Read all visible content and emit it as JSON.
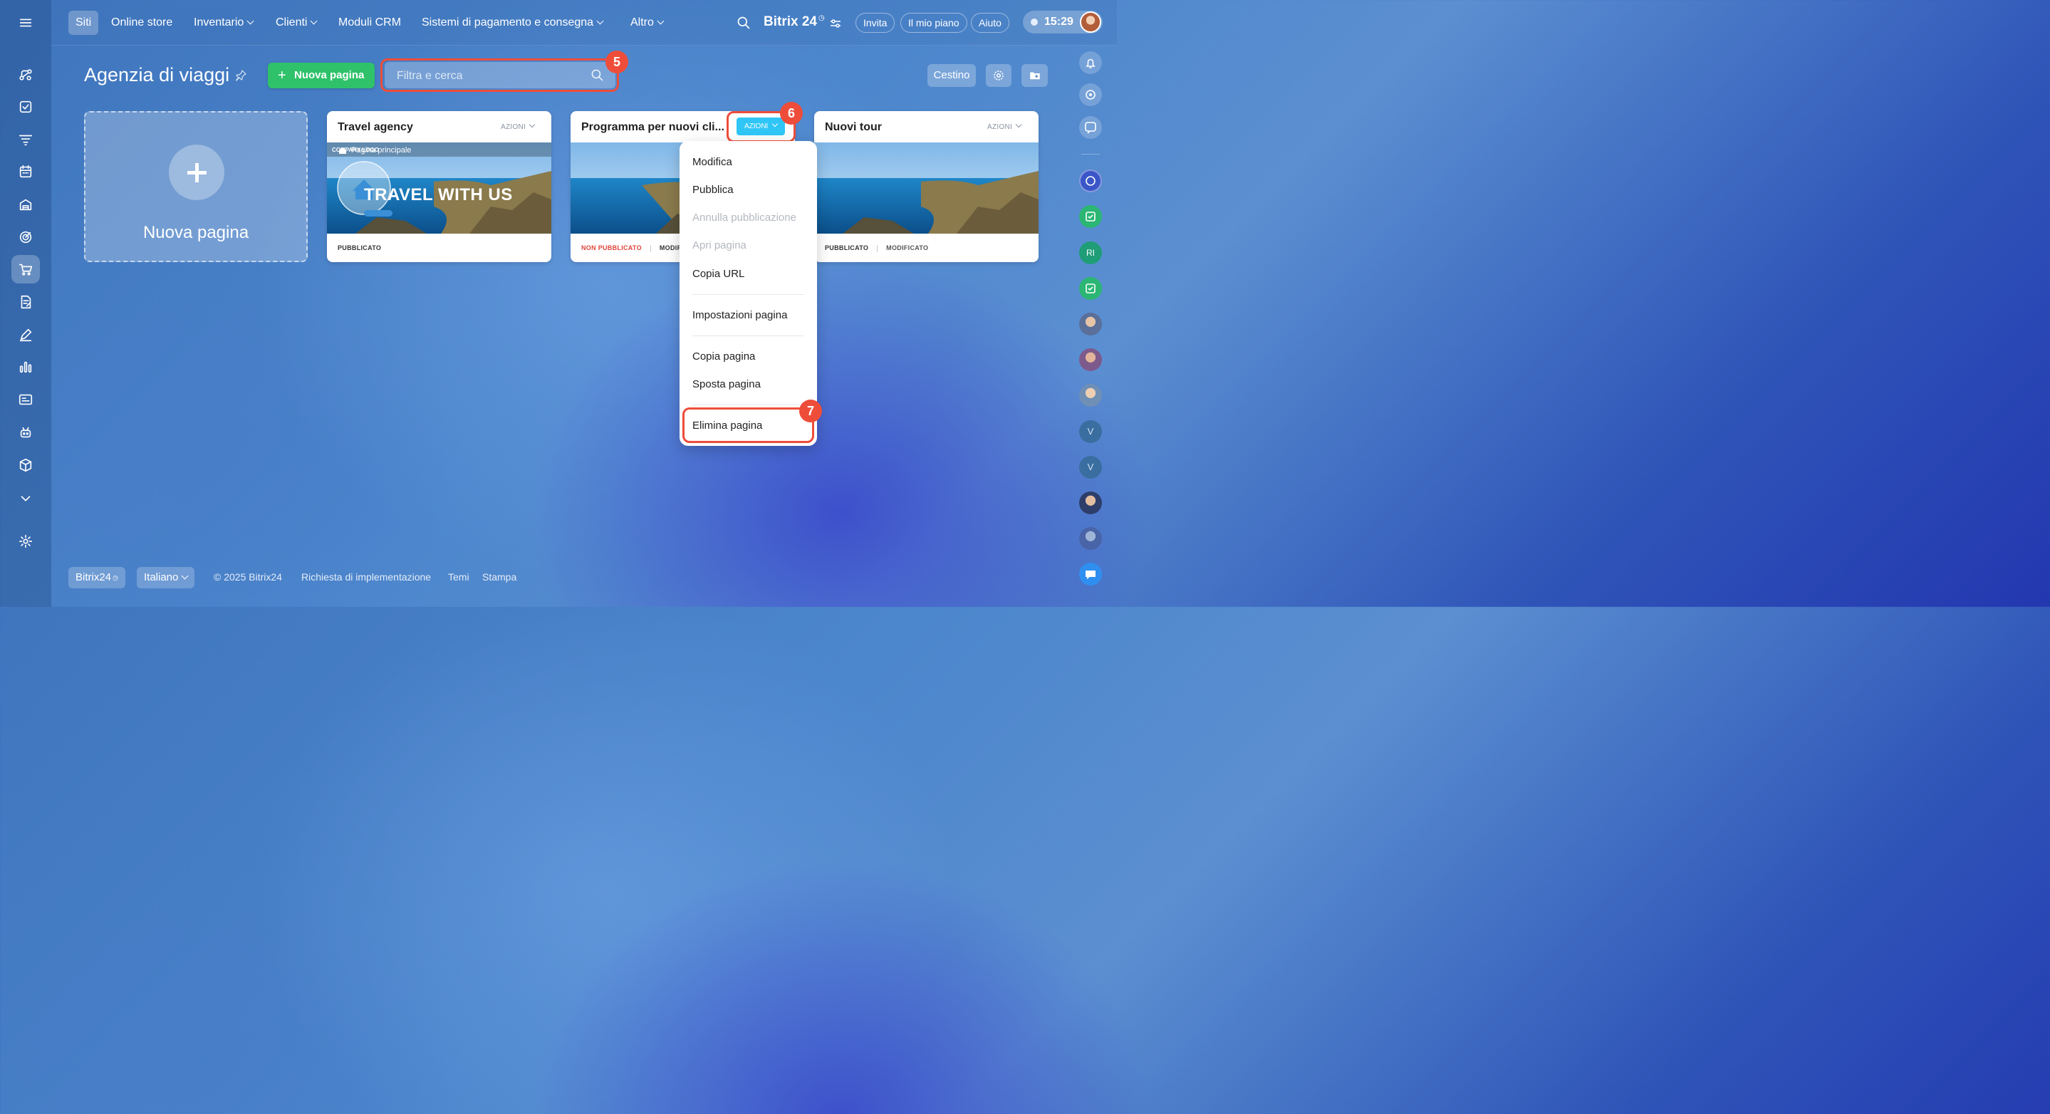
{
  "nav": {
    "menu_icon": "hamburger-icon",
    "items": [
      {
        "label": "Siti"
      },
      {
        "label": "Online store"
      },
      {
        "label": "Inventario"
      },
      {
        "label": "Clienti"
      },
      {
        "label": "Moduli CRM"
      },
      {
        "label": "Sistemi di pagamento e consegna"
      },
      {
        "label": "Altro"
      }
    ],
    "brand": "Bitrix 24",
    "invite": "Invita",
    "plan": "Il mio piano",
    "help": "Aiuto",
    "time": "15:29"
  },
  "page": {
    "title": "Agenzia di viaggi",
    "new_page_button": "Nuova pagina",
    "search_placeholder": "Filtra e cerca",
    "trash_button": "Cestino"
  },
  "annotations": {
    "search": "5",
    "actions": "6",
    "delete": "7"
  },
  "cards": {
    "new_card_label": "Nuova pagina",
    "items": [
      {
        "title": "Travel agency",
        "actions": "AZIONI",
        "status": "PUBBLICATO",
        "modified": "",
        "thumb_nav": "Pagina principale",
        "thumb_headline": "TRAVEL WITH US",
        "thumb_logo": "COMPANY LOGO"
      },
      {
        "title": "Programma per nuovi cli...",
        "actions": "AZIONI",
        "status": "NON PUBBLICATO",
        "modified": "MODIF"
      },
      {
        "title": "Nuovi tour",
        "actions": "AZIONI",
        "status": "PUBBLICATO",
        "modified": "MODIFICATO"
      }
    ]
  },
  "menu": {
    "items": [
      {
        "label": "Modifica",
        "enabled": true
      },
      {
        "label": "Pubblica",
        "enabled": true
      },
      {
        "label": "Annulla pubblicazione",
        "enabled": false
      },
      {
        "label": "Apri pagina",
        "enabled": false
      },
      {
        "label": "Copia URL",
        "enabled": true
      },
      {
        "label": "Impostazioni pagina",
        "enabled": true
      },
      {
        "label": "Copia pagina",
        "enabled": true
      },
      {
        "label": "Sposta pagina",
        "enabled": true
      },
      {
        "label": "Elimina pagina",
        "enabled": true
      }
    ]
  },
  "right_bar": {
    "avatars": [
      "RI",
      "V",
      "V"
    ]
  },
  "footer": {
    "brand": "Bitrix24",
    "language": "Italiano",
    "copyright": "© 2025 Bitrix24",
    "links": [
      "Richiesta di implementazione",
      "Temi",
      "Stampa"
    ]
  },
  "colors": {
    "accent_green": "#2fc26b",
    "actions_blue": "#2fc6f6",
    "highlight_red": "#ee4d3a",
    "unpublished_red": "#e0453b"
  }
}
